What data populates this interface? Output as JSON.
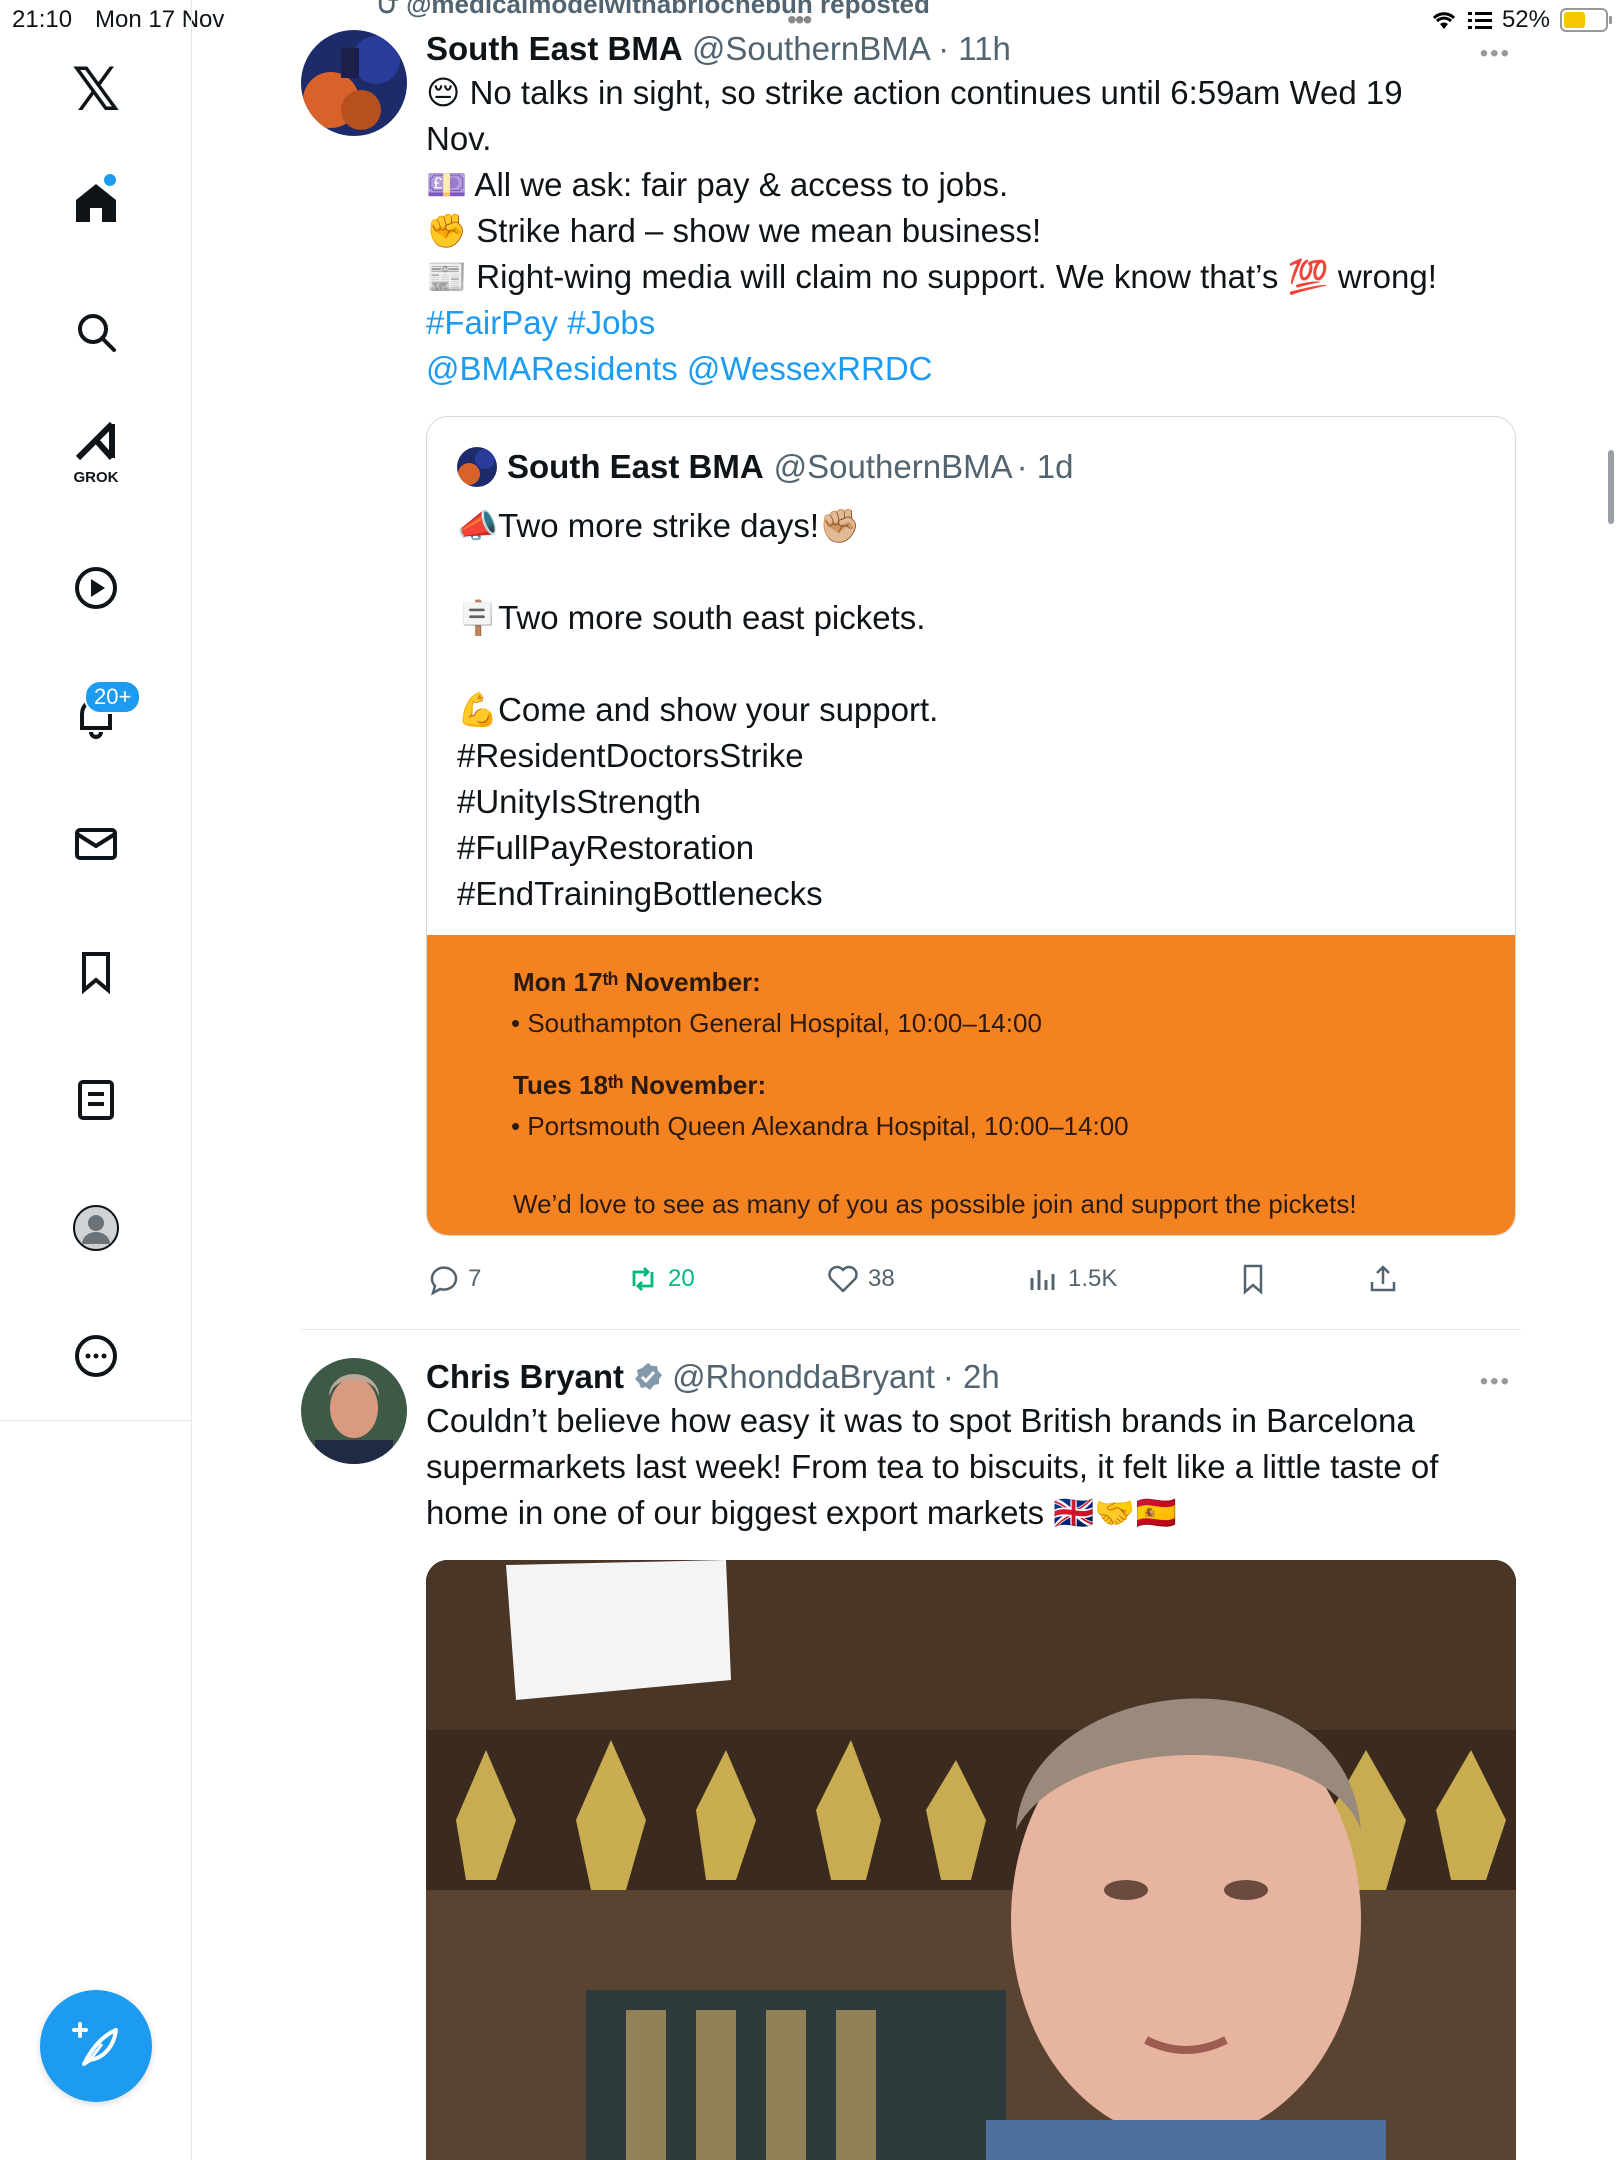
{
  "status_bar": {
    "time": "21:10",
    "date": "Mon 17 Nov",
    "battery": "52%",
    "battery_level": 0.52
  },
  "sidebar": {
    "items": [
      {
        "name": "x-logo",
        "label": "𝕏"
      },
      {
        "name": "home",
        "label": ""
      },
      {
        "name": "search",
        "label": ""
      },
      {
        "name": "grok",
        "label": "GROK"
      },
      {
        "name": "video",
        "label": ""
      },
      {
        "name": "notifications",
        "label": "",
        "badge": "20+"
      },
      {
        "name": "messages",
        "label": ""
      },
      {
        "name": "bookmarks",
        "label": ""
      },
      {
        "name": "lists",
        "label": ""
      },
      {
        "name": "profile",
        "label": ""
      },
      {
        "name": "more",
        "label": ""
      }
    ]
  },
  "feed": {
    "repost_banner": "@medicalmodelwithabriochebun reposted",
    "tweet1": {
      "name": "South East BMA",
      "handle": "@SouthernBMA",
      "time": "· 11h",
      "line1": "😔 No talks in sight, so strike action continues until 6:59am Wed 19",
      "line2": "Nov.",
      "line3": "💷 All we ask: fair pay & access to jobs.",
      "line4": "✊ Strike hard – show we mean business!",
      "line5_a": "📰 Right-wing media will claim no support. We know that’s",
      "line5_emoji": "💯",
      "line5_b": "wrong!",
      "hashtags": "#FairPay #Jobs",
      "mentions": "@BMAResidents @WessexRRDC",
      "quote": {
        "name": "South East BMA",
        "handle": "@SouthernBMA",
        "time": "· 1d",
        "lines": [
          "📣Two more strike days!✊🏼",
          "",
          "🪧Two more south east pickets.",
          "",
          "💪Come and show your support.",
          "#ResidentDoctorsStrike",
          "#UnityIsStrength",
          "#FullPayRestoration",
          "#EndTrainingBottlenecks"
        ],
        "image": {
          "day1_title": "Mon 17ᵗʰ November:",
          "day1_item": "•  Southampton General Hospital, 10:00–14:00",
          "day2_title": "Tues 18ᵗʰ November:",
          "day2_item": "•  Portsmouth Queen Alexandra Hospital, 10:00–14:00",
          "footer": "We’d love to see as many of you as possible join and support the pickets!"
        }
      },
      "actions": {
        "replies": "7",
        "reposts": "20",
        "likes": "38",
        "views": "1.5K"
      }
    },
    "tweet2": {
      "name": "Chris Bryant",
      "handle": "@RhonddaBryant",
      "time": "· 2h",
      "line1": "Couldn’t believe how easy it was to spot British brands in Barcelona",
      "line2": "supermarkets last week! From tea to biscuits, it felt like a little taste of",
      "line3": "home in one of our biggest export markets 🇬🇧🤝🇪🇸"
    }
  },
  "colors": {
    "accent": "#1d9bf0",
    "repost_green": "#00ba7c",
    "flyer_orange": "#f58220"
  }
}
